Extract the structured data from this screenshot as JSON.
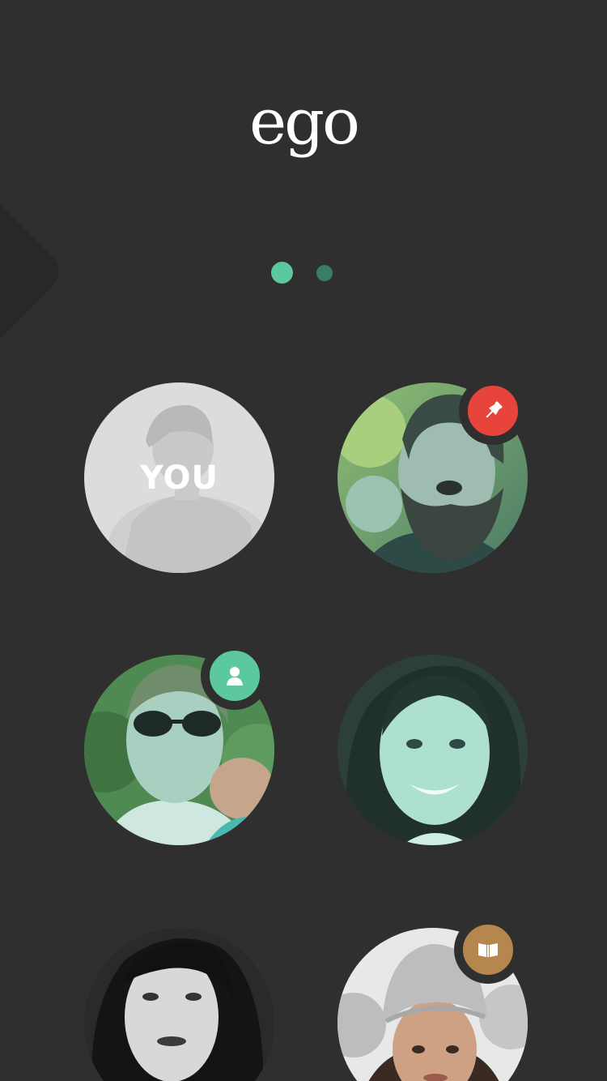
{
  "app": {
    "logo_text": "ego"
  },
  "pager": {
    "pages": 2,
    "active": 1
  },
  "colors": {
    "background": "#2f2f2f",
    "accent": "#5cc89d",
    "pin_badge": "#e7443b",
    "contact_badge": "#5cc89d",
    "book_badge": "#b5874f"
  },
  "grid": {
    "you_label": "YOU",
    "tiles": [
      {
        "kind": "you",
        "label": "YOU"
      },
      {
        "kind": "person",
        "badge_icon": "pin-icon"
      },
      {
        "kind": "person",
        "badge_icon": "person-icon"
      },
      {
        "kind": "person",
        "badge_icon": null
      },
      {
        "kind": "person",
        "badge_icon": null
      },
      {
        "kind": "person",
        "badge_icon": "book-icon"
      }
    ]
  }
}
